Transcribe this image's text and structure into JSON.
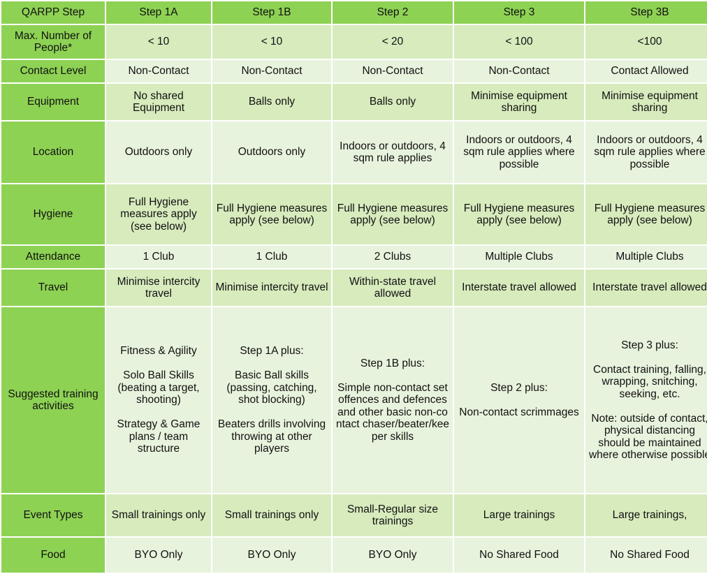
{
  "table": {
    "title": "QARPP Step",
    "colors": {
      "header_green": "#8ed254",
      "label_green": "#8ed254",
      "shade_light": "#e8f3dd",
      "shade_medium": "#d7ebbd",
      "gridline": "#ffffff",
      "text": "#111111"
    },
    "columns": [
      {
        "key": "label",
        "label": "QARPP Step"
      },
      {
        "key": "step1a",
        "label": "Step 1A"
      },
      {
        "key": "step1b",
        "label": "Step 1B"
      },
      {
        "key": "step2",
        "label": "Step 2"
      },
      {
        "key": "step3",
        "label": "Step 3"
      },
      {
        "key": "step3b",
        "label": "Step 3B"
      }
    ],
    "rows": [
      {
        "label": "Max. Number of People*",
        "cells": [
          "< 10",
          "< 10",
          "< 20",
          "< 100",
          "<100"
        ]
      },
      {
        "label": "Contact Level",
        "cells": [
          "Non-Contact",
          "Non-Contact",
          "Non-Contact",
          "Non-Contact",
          "Contact Allowed"
        ]
      },
      {
        "label": "Equipment",
        "cells": [
          "No shared Equipment",
          "Balls only",
          "Balls only",
          "Minimise equipment sharing",
          "Minimise equipment sharing"
        ]
      },
      {
        "label": "Location",
        "cells": [
          "Outdoors only",
          "Outdoors only",
          "Indoors or outdoors, 4 sqm rule applies",
          "Indoors or outdoors, 4 sqm rule applies where possible",
          "Indoors or outdoors, 4 sqm rule applies where possible"
        ]
      },
      {
        "label": "Hygiene",
        "cells": [
          "Full Hygiene measures apply (see below)",
          "Full Hygiene measures apply (see below)",
          "Full Hygiene measures apply (see below)",
          "Full Hygiene measures apply (see below)",
          "Full Hygiene measures apply (see below)"
        ]
      },
      {
        "label": "Attendance",
        "cells": [
          "1 Club",
          "1 Club",
          "2 Clubs",
          "Multiple Clubs",
          "Multiple Clubs"
        ]
      },
      {
        "label": "Travel",
        "cells": [
          "Minimise intercity travel",
          "Minimise intercity travel",
          "Within-state travel allowed",
          "Interstate travel allowed",
          "Interstate travel allowed"
        ]
      },
      {
        "label": "Suggested training activities",
        "cells": [
          "Fitness & Agility\n\nSolo Ball Skills (beating a target, shooting)\n\nStrategy & Game plans / team structure",
          "Step 1A plus:\n\nBasic Ball skills (passing, catching, shot blocking)\n\nBeaters drills involving throwing at other players",
          "Step 1B plus:\n\nSimple non-contact set offences and defences and other basic non-contact chaser/beater/keeper skills",
          "Step 2 plus:\n\nNon-contact scrimmages",
          "Step 3 plus:\n\nContact training, falling, wrapping, snitching, seeking, etc.\n\nNote: outside of contact, physical distancing should be maintained where otherwise possible"
        ]
      },
      {
        "label": "Event Types",
        "cells": [
          "Small trainings only",
          "Small trainings only",
          "Small-Regular size trainings",
          "Large trainings",
          "Large trainings,"
        ]
      },
      {
        "label": "Food",
        "cells": [
          "BYO Only",
          "BYO Only",
          "BYO Only",
          "No Shared Food",
          "No Shared Food"
        ]
      }
    ]
  }
}
